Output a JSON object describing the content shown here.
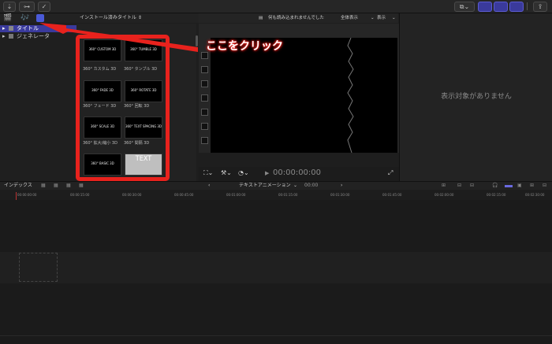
{
  "annotation": {
    "callout_text": "ここをクリック",
    "accent_color": "#e8221d"
  },
  "browser": {
    "dropdown_label": "インストール済みタイトル",
    "sidebar": [
      {
        "label": "タイトル",
        "selected": true
      },
      {
        "label": "ジェネレータ",
        "selected": false
      }
    ],
    "items": [
      {
        "thumb": "360° CUSTOM 3D",
        "label": "360° カスタム 3D"
      },
      {
        "thumb": "360° TUMBLE 3D",
        "label": "360° タンブル 3D"
      },
      {
        "thumb": "360° FADE 3D",
        "label": "360° フェード 3D"
      },
      {
        "thumb": "360° ROTATE 3D",
        "label": "360° 回転 3D"
      },
      {
        "thumb": "360° SCALE 3D",
        "label": "360° 拡大/縮小 3D"
      },
      {
        "thumb": "360° TEXT SPACING 3D",
        "label": "360° 間隔 3D"
      },
      {
        "thumb": "360° BASIC 3D",
        "label": ""
      },
      {
        "thumb": "TEXT",
        "label": ""
      }
    ]
  },
  "viewer": {
    "status_text": "何も読み込まれませんでした",
    "view_all": "全体表示",
    "display": "表示",
    "timecode": "00:00:00:00"
  },
  "inspector": {
    "empty_text": "表示対象がありません"
  },
  "timeline": {
    "index_label": "インデックス",
    "project_name": "テキストアニメーション",
    "duration": "00:00",
    "ruler": [
      "00:00:00:00",
      "00:00:15:00",
      "00:00:30:00",
      "00:00:45:00",
      "00:01:00:00",
      "00:01:15:00",
      "00:01:30:00",
      "00:01:45:00",
      "00:02:00:00",
      "00:02:15:00",
      "00:02:30:00"
    ]
  }
}
